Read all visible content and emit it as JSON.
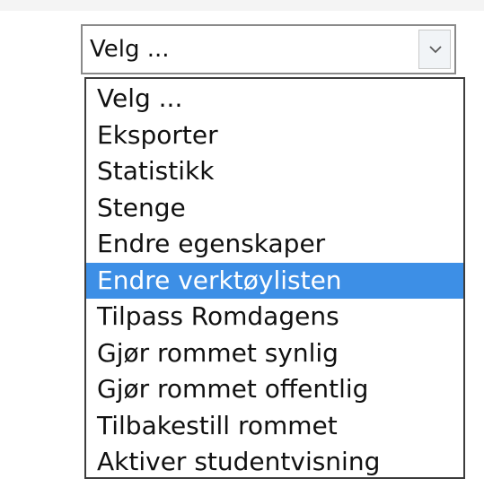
{
  "select": {
    "value": "Velg ...",
    "arrow_icon": "chevron-down-icon"
  },
  "options": [
    "Velg ...",
    "Eksporter",
    "Statistikk",
    "Stenge",
    "Endre egenskaper",
    "Endre verktøylisten",
    "Tilpass Romdagens",
    "Gjør rommet synlig",
    "Gjør rommet offentlig",
    "Tilbakestill rommet",
    "Aktiver studentvisning"
  ],
  "highlighted_option": "Endre verktøylisten",
  "colors": {
    "highlight": "#3d8fe6",
    "border": "#8a8a8a"
  }
}
